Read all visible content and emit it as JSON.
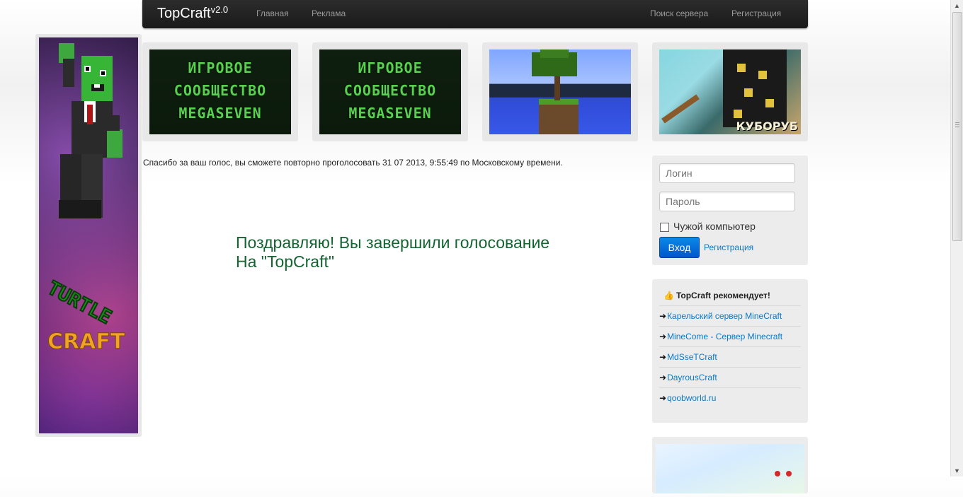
{
  "navbar": {
    "brand": "TopCraft",
    "brand_version": "v2.0",
    "links_left": [
      "Главная",
      "Реклама"
    ],
    "links_right": [
      "Поиск сервера",
      "Регистрация"
    ]
  },
  "left_banner": {
    "line1": "TURTLE",
    "line2": "CRAFT"
  },
  "top_banners": [
    {
      "lines": [
        "ИГРОВОЕ",
        "СООБЩЕСТВО",
        "MEGASEVEN"
      ]
    },
    {
      "lines": [
        "ИГРОВОЕ",
        "СООБЩЕСТВО",
        "MEGASEVEN"
      ]
    },
    {
      "lines": []
    },
    {
      "caption": "КУБОРУБ"
    }
  ],
  "vote_message": "Спасибо за ваш голос, вы сможете повторно проголосовать 31 07 2013, 9:55:49 по Московскому времени.",
  "congrats": {
    "line1": "Поздравляю! Вы завершили голосование",
    "line2": "На \"TopCraft\""
  },
  "login": {
    "login_placeholder": "Логин",
    "password_placeholder": "Пароль",
    "foreign_computer_label": "Чужой компьютер",
    "submit_label": "Вход",
    "register_link": "Регистрация"
  },
  "recommend": {
    "title": "TopCraft рекомендует!",
    "items": [
      "Карельский сервер MineCraft",
      "MineCome - Сервер Minecraft",
      "MdSseTCraft",
      "DayrousCraft",
      "qoobworld.ru"
    ]
  },
  "colors": {
    "link": "#0a79c8",
    "congrats": "#136431",
    "button": "#0a6fd8"
  }
}
